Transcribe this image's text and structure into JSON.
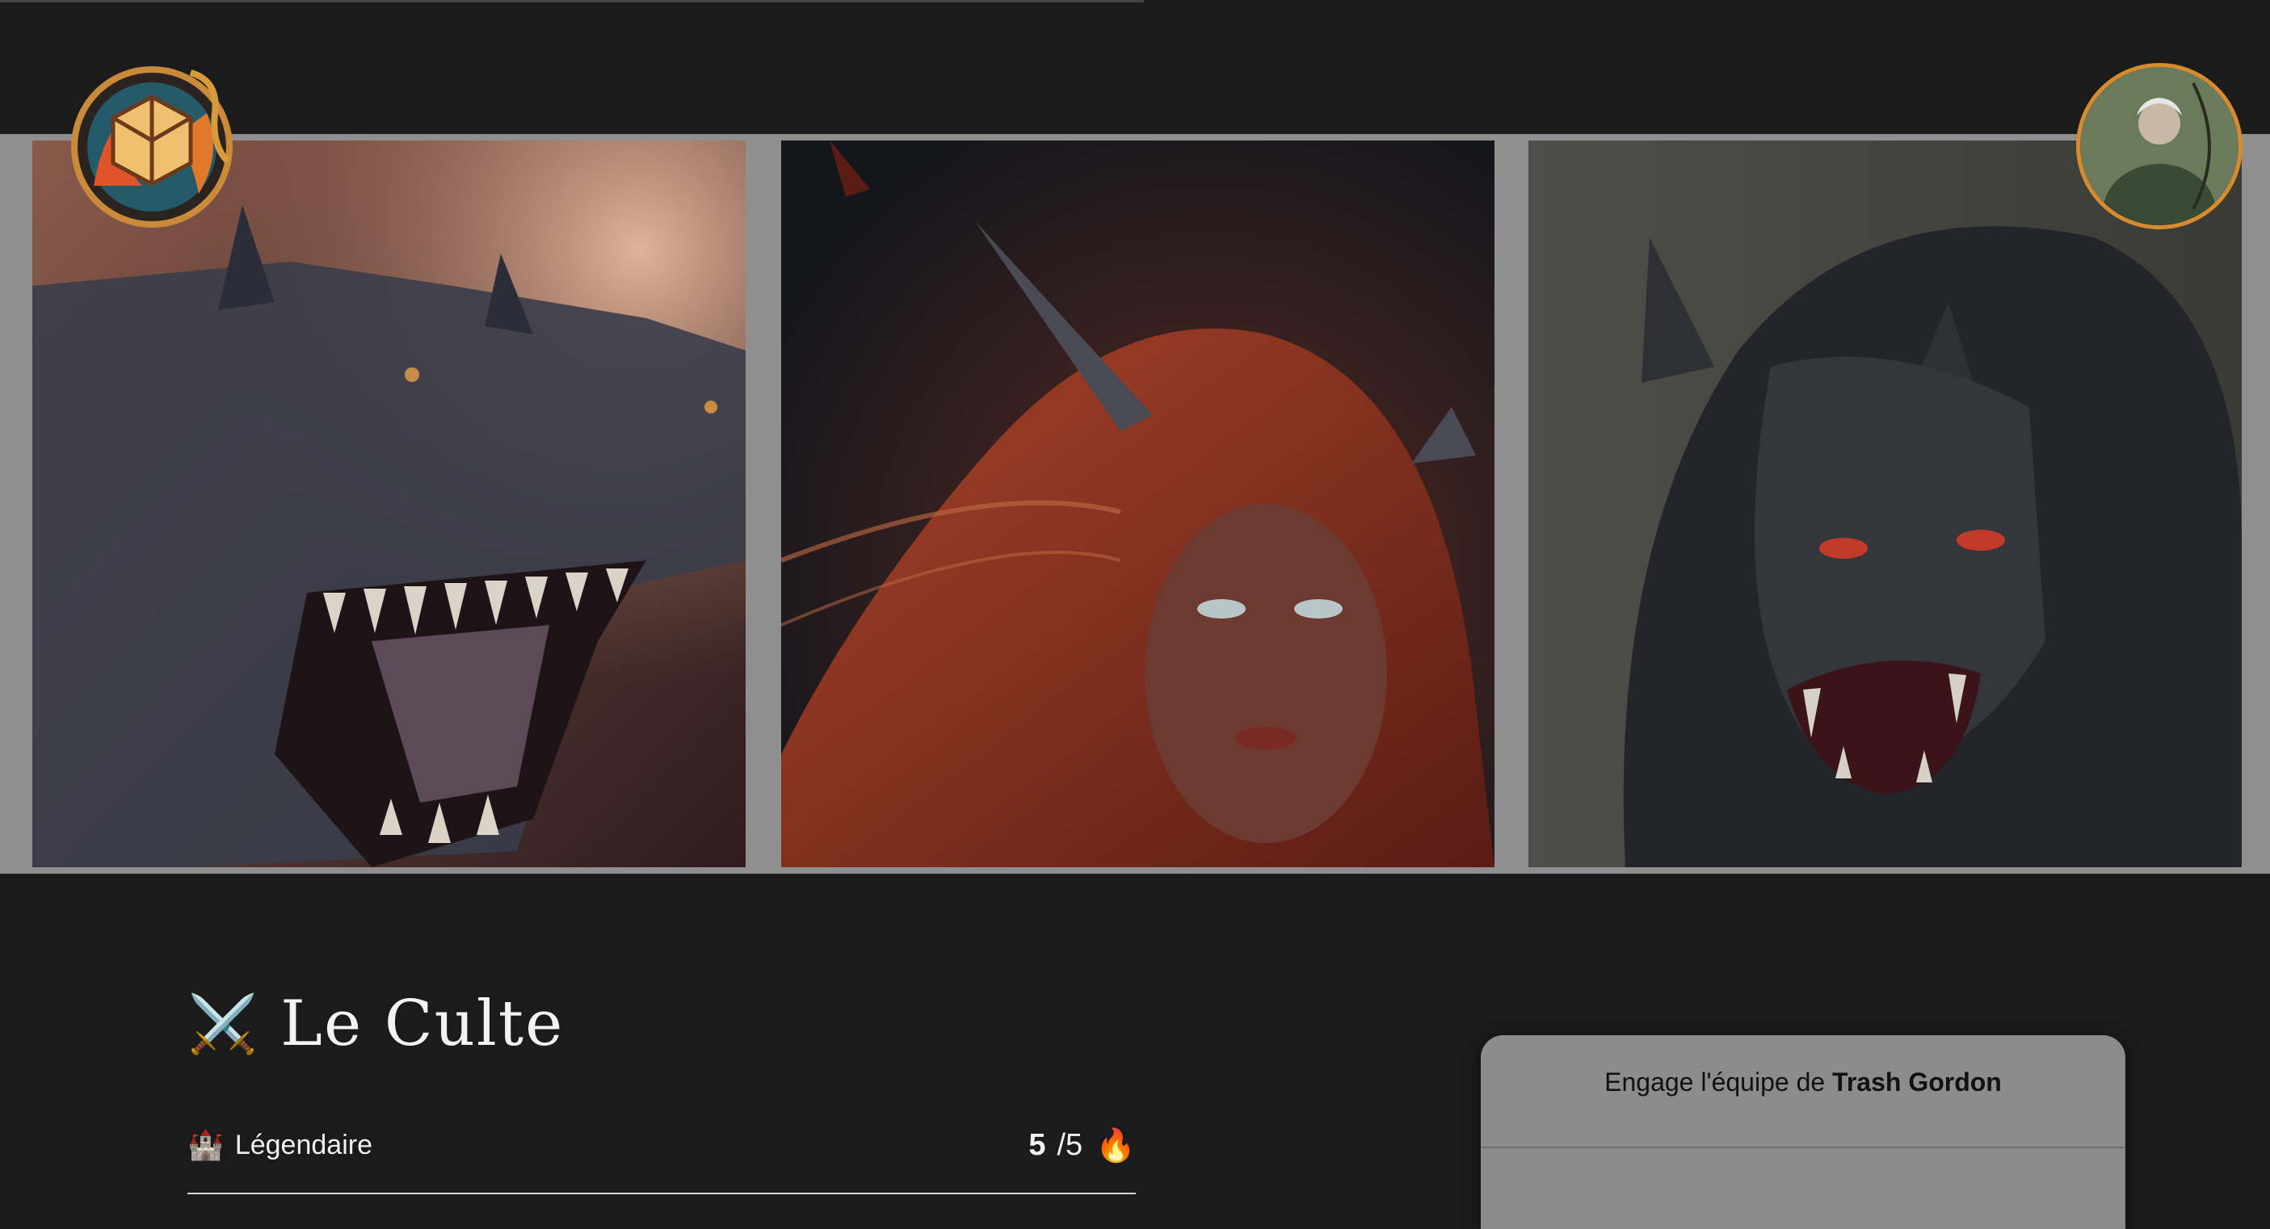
{
  "header": {
    "logo": "guild-emblem-dragon-logo",
    "avatar": "user-avatar-archer"
  },
  "gallery": {
    "images": [
      {
        "subject": "dragon-illustration"
      },
      {
        "subject": "red-haired-horned-woman-illustration"
      },
      {
        "subject": "werewolf-illustration"
      }
    ]
  },
  "guild": {
    "title_icon": "⚔️",
    "title": "Le Culte",
    "rank_icon": "🏰",
    "rank": "Légendaire",
    "score": "5",
    "score_max": "/5",
    "score_icon": "🔥"
  },
  "engage": {
    "prefix": "Engage l'équipe de ",
    "team_name": "Trash Gordon"
  },
  "colors": {
    "background": "#1b1b1b",
    "gallery_frame": "#8f8f8f",
    "card": "#8c8c8c",
    "accent_orange": "#d88a2d"
  }
}
